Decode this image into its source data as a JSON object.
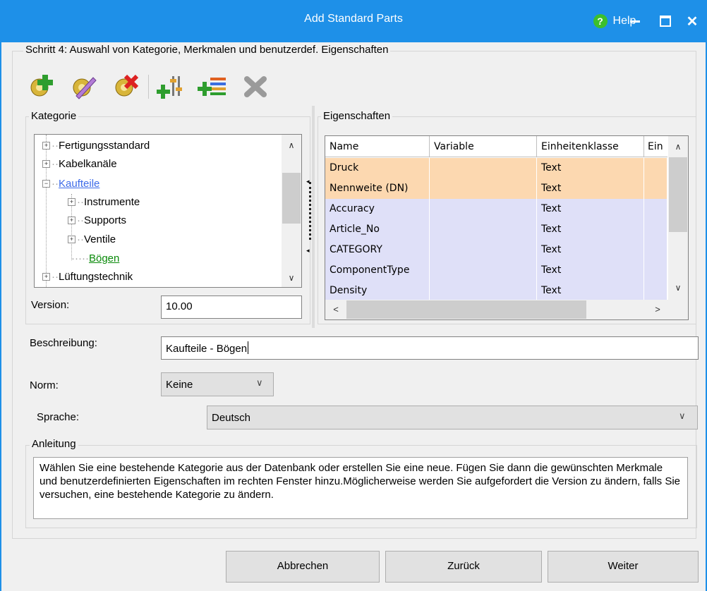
{
  "window": {
    "title": "Add Standard Parts",
    "help_label": "Help",
    "colors": {
      "titlebar": "#1e90e8",
      "row_selected": "#fcd8b0",
      "row_normal": "#dfe0f8",
      "link": "#3d6be8",
      "green": "#0a8a0a"
    }
  },
  "wizard": {
    "step_title": "Schritt 4: Auswahl von Kategorie, Merkmalen und benutzerdef. Eigenschaften"
  },
  "toolbar": {
    "icons": [
      "add-category-icon",
      "edit-category-icon",
      "delete-category-icon",
      "add-feature-icon",
      "add-property-icon",
      "remove-icon"
    ]
  },
  "kategorie": {
    "label": "Kategorie",
    "tree": [
      {
        "label": "Fertigungsstandard",
        "level": 0,
        "expander": "+"
      },
      {
        "label": "Kabelkanäle",
        "level": 0,
        "expander": "+"
      },
      {
        "label": "Kaufteile",
        "level": 0,
        "expander": "-",
        "state": "link"
      },
      {
        "label": "Instrumente",
        "level": 1,
        "expander": "+"
      },
      {
        "label": "Supports",
        "level": 1,
        "expander": "+"
      },
      {
        "label": "Ventile",
        "level": 1,
        "expander": "+"
      },
      {
        "label": "Bögen",
        "level": 1,
        "expander": "",
        "state": "selected"
      },
      {
        "label": "Lüftungstechnik",
        "level": 0,
        "expander": "+"
      }
    ],
    "version_label": "Version:",
    "version_value": "10.00"
  },
  "eigenschaften": {
    "label": "Eigenschaften",
    "columns": [
      "Name",
      "Variable",
      "Einheitenklasse",
      "Ein"
    ],
    "rows": [
      {
        "name": "Druck",
        "variable": "",
        "klasse": "Text",
        "selected": true
      },
      {
        "name": "Nennweite (DN)",
        "variable": "",
        "klasse": "Text",
        "selected": true
      },
      {
        "name": "Accuracy",
        "variable": "",
        "klasse": "Text",
        "selected": false
      },
      {
        "name": "Article_No",
        "variable": "",
        "klasse": "Text",
        "selected": false
      },
      {
        "name": "CATEGORY",
        "variable": "",
        "klasse": "Text",
        "selected": false
      },
      {
        "name": "ComponentType",
        "variable": "",
        "klasse": "Text",
        "selected": false
      },
      {
        "name": "Density",
        "variable": "",
        "klasse": "Text",
        "selected": false
      }
    ]
  },
  "form": {
    "beschreibung_label": "Beschreibung:",
    "beschreibung_value": "Kaufteile - Bögen",
    "norm_label": "Norm:",
    "norm_value": "Keine",
    "sprache_label": "Sprache:",
    "sprache_value": "Deutsch"
  },
  "anleitung": {
    "label": "Anleitung",
    "text": "Wählen Sie eine bestehende Kategorie aus der Datenbank oder erstellen Sie eine neue. Fügen Sie dann die gewünschten Merkmale und benutzerdefinierten Eigenschaften im rechten Fenster hinzu.Möglicherweise werden Sie aufgefordert die Version zu ändern, falls Sie versuchen, eine bestehende Kategorie zu ändern."
  },
  "buttons": {
    "cancel": "Abbrechen",
    "back": "Zurück",
    "next": "Weiter"
  }
}
